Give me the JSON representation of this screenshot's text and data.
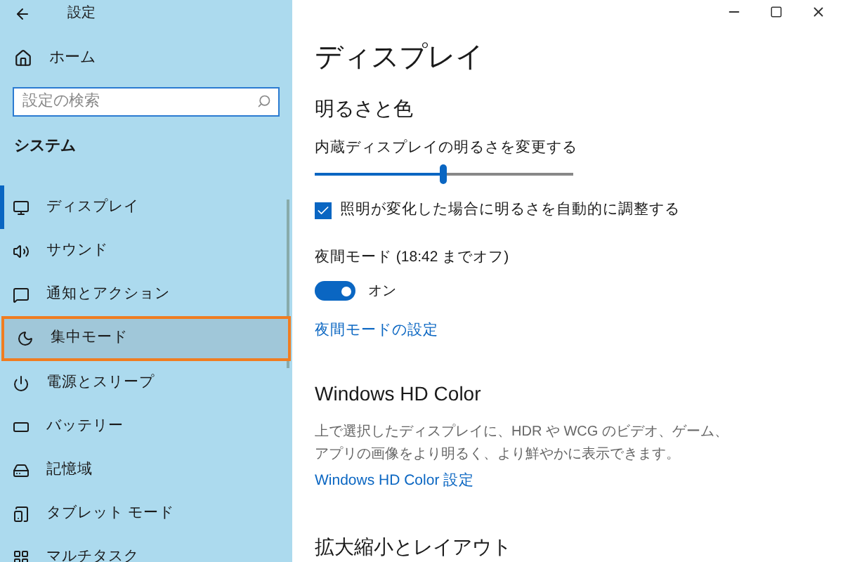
{
  "window": {
    "title": "設定"
  },
  "sidebar": {
    "home": "ホーム",
    "search": {
      "placeholder": "設定の検索"
    },
    "section": "システム",
    "items": [
      {
        "label": "ディスプレイ",
        "kind": "display",
        "selected": true,
        "highlighted": false
      },
      {
        "label": "サウンド",
        "kind": "sound",
        "selected": false,
        "highlighted": false
      },
      {
        "label": "通知とアクション",
        "kind": "notifications",
        "selected": false,
        "highlighted": false
      },
      {
        "label": "集中モード",
        "kind": "focus",
        "selected": false,
        "highlighted": true
      },
      {
        "label": "電源とスリープ",
        "kind": "power",
        "selected": false,
        "highlighted": false
      },
      {
        "label": "バッテリー",
        "kind": "battery",
        "selected": false,
        "highlighted": false
      },
      {
        "label": "記憶域",
        "kind": "storage",
        "selected": false,
        "highlighted": false
      },
      {
        "label": "タブレット モード",
        "kind": "tablet",
        "selected": false,
        "highlighted": false
      },
      {
        "label": "マルチタスク",
        "kind": "multitask",
        "selected": false,
        "highlighted": false
      }
    ]
  },
  "content": {
    "title": "ディスプレイ",
    "brightness": {
      "heading": "明るさと色",
      "slider_label": "内蔵ディスプレイの明るさを変更する",
      "level": 0.5,
      "auto": {
        "label": "照明が変化した場合に明るさを自動的に調整する",
        "checked": true
      },
      "night": {
        "label": "夜間モード (18:42 までオフ)",
        "on": true,
        "state_text": "オン",
        "link": "夜間モードの設定"
      }
    },
    "hd": {
      "heading": "Windows HD Color",
      "description": "上で選択したディスプレイに、HDR や WCG のビデオ、ゲーム、アプリの画像をより明るく、より鮮やかに表示できます。",
      "link": "Windows HD Color 設定"
    },
    "scale": {
      "heading": "拡大縮小とレイアウト"
    }
  }
}
